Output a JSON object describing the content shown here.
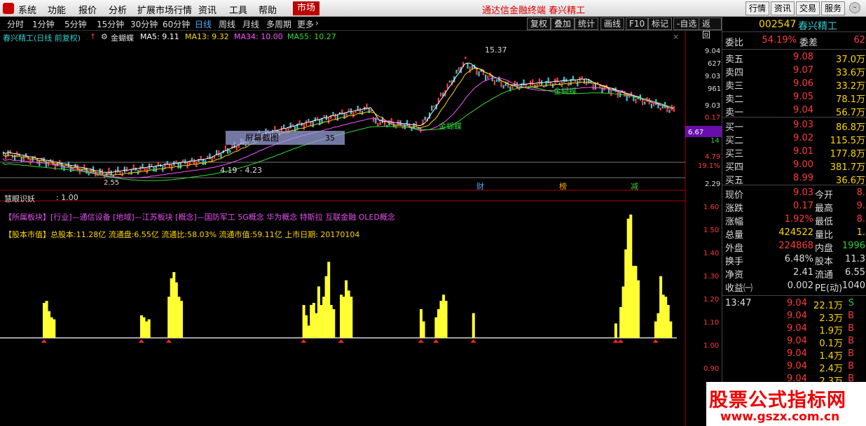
{
  "menubar": {
    "items": [
      "系统",
      "功能",
      "报价",
      "分析",
      "扩展市场行情",
      "资讯",
      "工具",
      "帮助"
    ],
    "active": "市场",
    "brand": "通达信金融终端  春兴精工",
    "right_buttons": [
      "行情",
      "资讯",
      "交易",
      "服务"
    ]
  },
  "periodbar": {
    "periods": [
      "分时",
      "1分钟",
      "5分钟",
      "15分钟",
      "30分钟",
      "60分钟",
      "日线",
      "周线",
      "月线",
      "多周期",
      "更多"
    ],
    "selected": "日线",
    "tools": [
      "复权",
      "叠加",
      "统计",
      "画线",
      "F10",
      "标记",
      "-自选",
      "返回"
    ]
  },
  "chart": {
    "title": "春兴精工(日线 前复权)",
    "indicator": "金蝴蝶",
    "ma": [
      {
        "label": "MA5: 9.11",
        "color": "#ffffff"
      },
      {
        "label": "MA13: 9.32",
        "color": "#ffd700"
      },
      {
        "label": "MA34: 10.00",
        "color": "#ff55ff"
      },
      {
        "label": "MA55: 10.27",
        "color": "#33dd33"
      }
    ],
    "price_axis": [
      "9.04",
      "627",
      "9.03",
      "961",
      "9.03",
      "0.17",
      "6.67",
      "14",
      "4.79",
      "19.1%",
      "2.29"
    ],
    "annotations": {
      "high": "15.37",
      "low_range": "4.19 - 4.23",
      "low": "2.55",
      "screenshot_label": "屏幕截图",
      "box_value": "35",
      "butterfly": "金蝴蝶",
      "markers": [
        "财",
        "榜",
        "减"
      ]
    },
    "sub_indicator": {
      "name": "慧眼识妖",
      "value": ": 1.00",
      "sector_line": "【所属板块】[行业]—通信设备 [地域]—江苏板块 [概念]—国防军工 5G概念 华为概念 特斯拉 互联金融 OLED概念",
      "cap_line": "【股本市值】总股本:11.28亿 流通盘:6.55亿 流通比:58.03% 流通市值:59.11亿 上市日期: 20170104",
      "axis": [
        "1.60",
        "1.50",
        "1.40",
        "1.30",
        "1.20",
        "1.10",
        "1.00",
        "0.90"
      ]
    }
  },
  "chart_data": {
    "type": "bar",
    "series_name": "慧眼识妖",
    "baseline": 1.0,
    "ylim": [
      0.84,
      1.65
    ],
    "values": [
      1.0,
      1.0,
      1.0,
      1.0,
      1.0,
      1.0,
      1.0,
      1.0,
      1.0,
      1.0,
      1.0,
      1.0,
      1.0,
      1.0,
      1.0,
      1.0,
      1.17,
      1.18,
      1.13,
      1.1,
      1.09,
      1.0,
      1.0,
      1.0,
      1.0,
      1.0,
      1.0,
      1.0,
      1.0,
      1.0,
      1.0,
      1.0,
      1.0,
      1.0,
      1.0,
      1.0,
      1.0,
      1.0,
      1.0,
      1.0,
      1.0,
      1.0,
      1.0,
      1.0,
      1.0,
      1.0,
      1.0,
      1.0,
      1.0,
      1.0,
      1.0,
      1.0,
      1.0,
      1.0,
      1.0,
      1.11,
      1.1,
      1.08,
      1.09,
      1.0,
      1.0,
      1.0,
      1.0,
      1.0,
      1.0,
      1.0,
      1.2,
      1.29,
      1.32,
      1.27,
      1.2,
      1.18,
      1.0,
      1.0,
      1.0,
      1.0,
      1.0,
      1.0,
      1.0,
      1.0,
      1.0,
      1.0,
      1.0,
      1.0,
      1.0,
      1.0,
      1.0,
      1.0,
      1.0,
      1.0,
      1.0,
      1.0,
      1.0,
      1.0,
      1.0,
      1.0,
      1.0,
      1.0,
      1.0,
      1.0,
      1.0,
      1.0,
      1.0,
      1.0,
      1.0,
      1.0,
      1.0,
      1.0,
      1.0,
      1.0,
      1.0,
      1.0,
      1.0,
      1.0,
      1.0,
      1.0,
      1.0,
      1.0,
      1.0,
      1.0,
      1.16,
      1.11,
      1.06,
      1.16,
      1.17,
      1.12,
      1.25,
      1.16,
      1.2,
      1.3,
      1.37,
      1.16,
      1.14,
      1.0,
      1.0,
      1.21,
      1.2,
      1.28,
      1.23,
      1.2,
      1.0,
      1.0,
      1.0,
      1.0,
      1.0,
      1.0,
      1.0,
      1.0,
      1.0,
      1.0,
      1.0,
      1.0,
      1.0,
      1.0,
      1.0,
      1.0,
      1.0,
      1.0,
      1.0,
      1.0,
      1.0,
      1.0,
      1.0,
      1.0,
      1.0,
      1.0,
      1.0,
      1.14,
      1.08,
      1.0,
      1.0,
      1.0,
      1.0,
      1.1,
      1.14,
      1.18,
      1.21,
      1.18,
      1.0,
      1.0,
      1.0,
      1.0,
      1.0,
      1.0,
      1.0,
      1.0,
      1.0,
      1.0,
      1.12,
      1.0,
      1.0,
      1.0,
      1.0,
      1.0,
      1.0,
      1.0,
      1.0,
      1.0,
      1.0,
      1.0,
      1.0,
      1.0,
      1.0,
      1.0,
      1.0,
      1.0,
      1.0,
      1.0,
      1.0,
      1.0,
      1.0,
      1.0,
      1.0,
      1.0,
      1.0,
      1.0,
      1.0,
      1.0,
      1.0,
      1.0,
      1.0,
      1.0,
      1.0,
      1.0,
      1.0,
      1.0,
      1.0,
      1.0,
      1.0,
      1.0,
      1.0,
      1.0,
      1.0,
      1.0,
      1.0,
      1.0,
      1.0,
      1.0,
      1.0,
      1.0,
      1.0,
      1.0,
      1.0,
      1.0,
      1.0,
      1.07,
      1.0,
      1.15,
      1.25,
      1.43,
      1.58,
      1.6,
      1.35,
      1.35,
      1.28,
      1.0,
      1.0,
      1.0,
      1.0,
      1.0,
      1.0,
      1.08,
      1.12,
      1.3,
      1.21,
      1.2,
      1.16,
      1.08,
      1.0,
      1.0
    ]
  },
  "rpanel": {
    "code": "002547",
    "name": "春兴精工",
    "weibi": {
      "label": "委比",
      "value": "54.19%",
      "label2": "委差",
      "value2": "62"
    },
    "asks": [
      {
        "label": "卖五",
        "price": "9.08",
        "vol": "37.0万"
      },
      {
        "label": "卖四",
        "price": "9.07",
        "vol": "33.6万"
      },
      {
        "label": "卖三",
        "price": "9.06",
        "vol": "33.2万"
      },
      {
        "label": "卖二",
        "price": "9.05",
        "vol": "78.1万"
      },
      {
        "label": "卖一",
        "price": "9.04",
        "vol": "56.7万"
      }
    ],
    "bids": [
      {
        "label": "买一",
        "price": "9.03",
        "vol": "86.8万"
      },
      {
        "label": "买二",
        "price": "9.02",
        "vol": "115.5万"
      },
      {
        "label": "买三",
        "price": "9.01",
        "vol": "177.8万"
      },
      {
        "label": "买四",
        "price": "9.00",
        "vol": "381.7万"
      },
      {
        "label": "买五",
        "price": "8.99",
        "vol": "36.6万"
      }
    ],
    "stats": [
      {
        "l1": "现价",
        "v1": "9.03",
        "c1": "red",
        "l2": "今开",
        "v2": "8.",
        "c2": "red"
      },
      {
        "l1": "涨跌",
        "v1": "0.17",
        "c1": "red",
        "l2": "最高",
        "v2": "9.",
        "c2": "red"
      },
      {
        "l1": "涨幅",
        "v1": "1.92%",
        "c1": "red",
        "l2": "最低",
        "v2": "8.",
        "c2": "red"
      },
      {
        "l1": "总量",
        "v1": "424522",
        "c1": "yel",
        "l2": "量比",
        "v2": "1.",
        "c2": "yel"
      },
      {
        "l1": "外盘",
        "v1": "224868",
        "c1": "red",
        "l2": "内盘",
        "v2": "1996",
        "c2": "grn"
      },
      {
        "l1": "换手",
        "v1": "6.48%",
        "c1": "wht",
        "l2": "股本",
        "v2": "11.3",
        "c2": "wht"
      },
      {
        "l1": "净资",
        "v1": "2.41",
        "c1": "wht",
        "l2": "流通",
        "v2": "6.55",
        "c2": "wht"
      },
      {
        "l1": "收益㈠",
        "v1": "0.002",
        "c1": "wht",
        "l2": "PE(动)",
        "v2": "1040",
        "c2": "wht"
      }
    ],
    "ticks": [
      {
        "time": "13:47",
        "price": "9.04",
        "vol": "22.1万",
        "bs": "S"
      },
      {
        "time": "",
        "price": "9.04",
        "vol": "2.3万",
        "bs": "B"
      },
      {
        "time": "",
        "price": "9.04",
        "vol": "1.9万",
        "bs": "B"
      },
      {
        "time": "",
        "price": "9.04",
        "vol": "0.1万",
        "bs": "B"
      },
      {
        "time": "",
        "price": "9.04",
        "vol": "1.4万",
        "bs": "B"
      },
      {
        "time": "",
        "price": "9.04",
        "vol": "2.4万",
        "bs": "B"
      },
      {
        "time": "",
        "price": "9.04",
        "vol": "2.3万",
        "bs": "B"
      }
    ]
  },
  "watermark": {
    "line1": "股票公式指标网",
    "line2": "www.gszx.com.cn"
  }
}
